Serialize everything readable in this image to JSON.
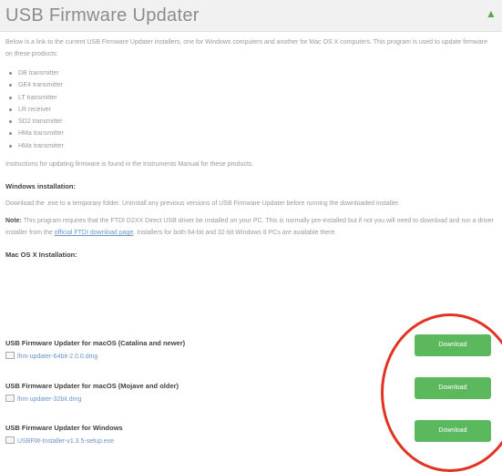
{
  "header": {
    "title": "USB Firmware Updater",
    "toggle_icon": "chevron-up-icon"
  },
  "intro": "Below is a link to the current USB Firmware Updater installers, one for Windows computers and another for Mac OS X computers. This program is used to update firmware on these products:",
  "products": [
    "DB transmitter",
    "GE4 transmitter",
    "LT transmitter",
    "LR receiver",
    "SD2 transmitter",
    "HMa transmitter",
    "HMa transmitter"
  ],
  "instructions": "Instructions for updating firmware is found in the Instruments Manual for these products.",
  "windows": {
    "heading": "Windows installation:",
    "text": "Download the .exe to a temporary folder. Uninstall any previous versions of USB Firmware Updater before running the downloaded installer.",
    "note_label": "Note:",
    "note_text_1": "This program requires that the FTDI D2XX Direct USB driver be installed on your PC. This is normally pre-installed but if not you will need to download and run a driver installer from the",
    "note_link": "official FTDI download page",
    "note_text_2": ". Installers for both 64-bit and 32-bit Windows 8 PCs are available there."
  },
  "mac": {
    "heading": "Mac OS X Installation:"
  },
  "downloads": [
    {
      "title": "USB Firmware Updater for macOS (Catalina and newer)",
      "file": "lhm-updater-64bit-2.0.0.dmg",
      "button": "Download"
    },
    {
      "title": "USB Firmware Updater for macOS (Mojave and older)",
      "file": "lhm-updater-32bit.dmg",
      "button": "Download"
    },
    {
      "title": "USB Firmware Updater for Windows",
      "file": "USBFW-Installer-v1.3.5-setup.exe",
      "button": "Download"
    }
  ],
  "colors": {
    "accent_green": "#5cb85c",
    "link_blue": "#6a95c9",
    "highlight_red": "#e23322"
  }
}
